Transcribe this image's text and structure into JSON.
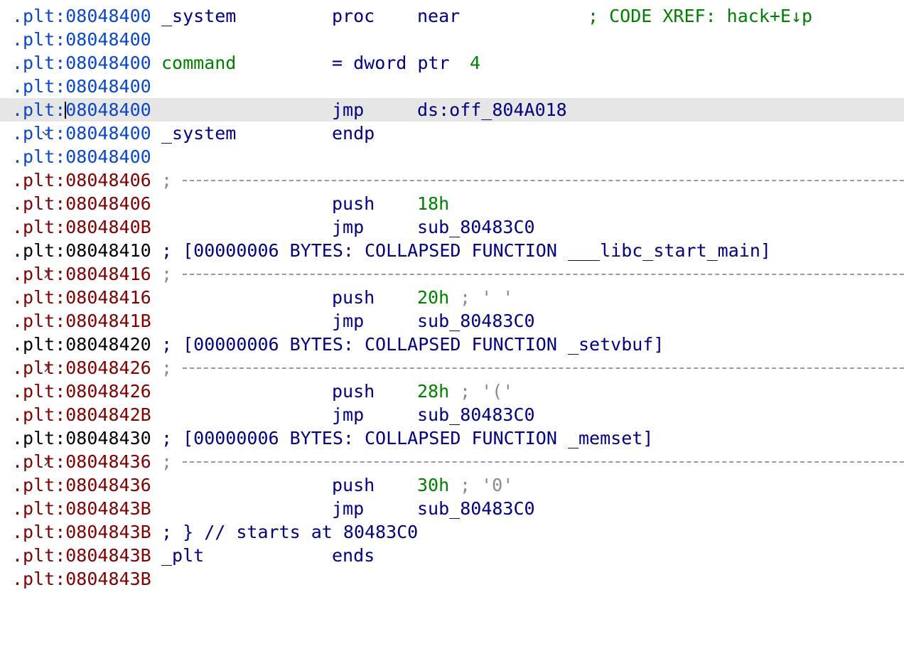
{
  "colors": {
    "text_address": "#0a47c9",
    "data_address": "#800000",
    "mnemonic": "#000080",
    "number": "#008000",
    "comment": "#8a8a8a",
    "selection": "#e6e6e6"
  },
  "listing": {
    "l1": {
      "addr": ".plt:08048400",
      "name": "_system",
      "mnemonic": "proc",
      "operand": "near",
      "xref": "; CODE XREF: hack+E↓p"
    },
    "l2": {
      "addr": ".plt:08048400"
    },
    "l3": {
      "addr": ".plt:08048400",
      "name": "command",
      "mnemonic": "= dword ptr",
      "operand": "4"
    },
    "l4": {
      "addr": ".plt:08048400"
    },
    "l5": {
      "gutter": "chevron-down-icon",
      "addr_seg": ".plt:",
      "addr_off": "08048400",
      "mnemonic": "jmp",
      "operand": "ds:off_804A018"
    },
    "l6": {
      "addr": ".plt:08048400",
      "name": "_system",
      "mnemonic": "endp"
    },
    "l7": {
      "addr": ".plt:08048400"
    },
    "l8": {
      "addr": ".plt:08048406",
      "sep_prefix": ";"
    },
    "l9": {
      "addr": ".plt:08048406",
      "mnemonic": "push",
      "operand": "18h"
    },
    "l10": {
      "addr": ".plt:0804840B",
      "mnemonic": "jmp",
      "operand": "sub_80483C0"
    },
    "l11": {
      "gutter": "chevron-right-icon",
      "addr": ".plt:08048410",
      "comment": "; [00000006 BYTES: COLLAPSED FUNCTION ___libc_start_main]"
    },
    "l12": {
      "addr": ".plt:08048416",
      "sep_prefix": ";"
    },
    "l13": {
      "addr": ".plt:08048416",
      "mnemonic": "push",
      "operand": "20h",
      "comment": "; ' '"
    },
    "l14": {
      "addr": ".plt:0804841B",
      "mnemonic": "jmp",
      "operand": "sub_80483C0"
    },
    "l15": {
      "gutter": "chevron-right-icon",
      "addr": ".plt:08048420",
      "comment": "; [00000006 BYTES: COLLAPSED FUNCTION _setvbuf]"
    },
    "l16": {
      "addr": ".plt:08048426",
      "sep_prefix": ";"
    },
    "l17": {
      "addr": ".plt:08048426",
      "mnemonic": "push",
      "operand": "28h",
      "comment": "; '('"
    },
    "l18": {
      "addr": ".plt:0804842B",
      "mnemonic": "jmp",
      "operand": "sub_80483C0"
    },
    "l19": {
      "gutter": "chevron-right-icon",
      "addr": ".plt:08048430",
      "comment": "; [00000006 BYTES: COLLAPSED FUNCTION _memset]"
    },
    "l20": {
      "addr": ".plt:08048436",
      "sep_prefix": ";"
    },
    "l21": {
      "addr": ".plt:08048436",
      "mnemonic": "push",
      "operand": "30h",
      "comment": "; '0'"
    },
    "l22": {
      "addr": ".plt:0804843B",
      "mnemonic": "jmp",
      "operand": "sub_80483C0"
    },
    "l23": {
      "addr": ".plt:0804843B",
      "comment": "; } // starts at 80483C0"
    },
    "l24": {
      "addr": ".plt:0804843B",
      "name": "_plt",
      "mnemonic": "ends"
    },
    "l25": {
      "addr": ".plt:0804843B"
    }
  }
}
